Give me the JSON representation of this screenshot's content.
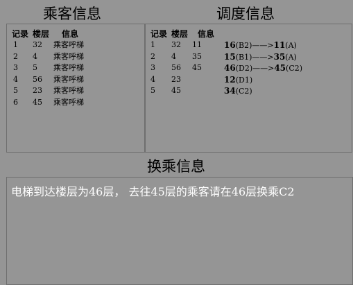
{
  "passenger": {
    "title": "乘客信息",
    "headers": [
      "记录",
      "楼层",
      "信息"
    ],
    "rows": [
      {
        "id": "1",
        "floor": "32",
        "info": "乘客呼梯"
      },
      {
        "id": "2",
        "floor": "4",
        "info": "乘客呼梯"
      },
      {
        "id": "3",
        "floor": "5",
        "info": "乘客呼梯"
      },
      {
        "id": "4",
        "floor": "56",
        "info": "乘客呼梯"
      },
      {
        "id": "5",
        "floor": "23",
        "info": "乘客呼梯"
      },
      {
        "id": "6",
        "floor": "45",
        "info": "乘客呼梯"
      }
    ]
  },
  "dispatch": {
    "title": "调度信息",
    "headers": [
      "记录",
      "楼层",
      "信息"
    ],
    "rows": [
      {
        "id": "1",
        "floor": "32",
        "col3": "11",
        "from": "16",
        "from_tag": "(B2)",
        "arrow": "——>",
        "to": "11",
        "to_tag": "(A)"
      },
      {
        "id": "2",
        "floor": "4",
        "col3": "35",
        "from": "15",
        "from_tag": "(B1)",
        "arrow": "——>",
        "to": "35",
        "to_tag": "(A)"
      },
      {
        "id": "3",
        "floor": "56",
        "col3": "45",
        "from": "46",
        "from_tag": "(D2)",
        "arrow": "——>",
        "to": "45",
        "to_tag": "(C2)"
      },
      {
        "id": "4",
        "floor": "23",
        "col3": "",
        "from": "12",
        "from_tag": "(D1)",
        "arrow": "",
        "to": "",
        "to_tag": ""
      },
      {
        "id": "5",
        "floor": "45",
        "col3": "",
        "from": "34",
        "from_tag": "(C2)",
        "arrow": "",
        "to": "",
        "to_tag": ""
      }
    ]
  },
  "transfer": {
    "title": "换乘信息",
    "message": "电梯到达楼层为46层， 去往45层的乘客请在46层换乘C2"
  }
}
